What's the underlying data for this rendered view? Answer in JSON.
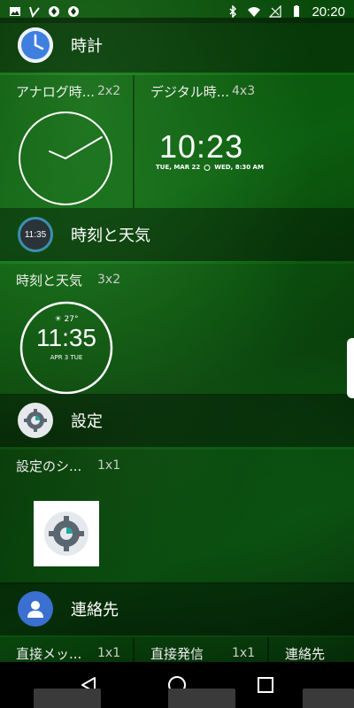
{
  "status_bar": {
    "time": "20:20",
    "left_icons": [
      "image-icon",
      "checkmark-icon",
      "diamond-icon",
      "diamond-icon"
    ],
    "right_icons": [
      "bluetooth-icon",
      "wifi-icon",
      "no-signal-icon",
      "battery-icon"
    ]
  },
  "sections": [
    {
      "app_name": "時計",
      "icon": "clock-app-icon",
      "widgets": [
        {
          "title": "アナログ時...",
          "size": "2x2",
          "preview": "analog-clock"
        },
        {
          "title": "デジタル時...",
          "size": "4x3",
          "preview": "digital-clock",
          "digital_time": "10:23",
          "digital_date": "TUE, MAR 22",
          "digital_alarm": "WED, 8:30 AM"
        }
      ]
    },
    {
      "app_name": "時刻と天気",
      "icon": "time-weather-app-icon",
      "icon_time": "11:35",
      "widgets": [
        {
          "title": "時刻と天気",
          "size": "3x2",
          "preview": "time-weather",
          "temp": "27°",
          "time": "11:35",
          "date": "APR 3 TUE"
        }
      ]
    },
    {
      "app_name": "設定",
      "icon": "settings-app-icon",
      "widgets": [
        {
          "title": "設定のシ...",
          "size": "1x1",
          "preview": "settings-shortcut"
        }
      ]
    },
    {
      "app_name": "連絡先",
      "icon": "contacts-app-icon",
      "widgets": [
        {
          "title": "直接メッ...",
          "size": "1x1"
        },
        {
          "title": "直接発信",
          "size": "1x1"
        },
        {
          "title": "連絡先",
          "size": ""
        }
      ]
    }
  ],
  "nav": {
    "back": "back-icon",
    "home": "home-icon",
    "recents": "recents-icon"
  }
}
